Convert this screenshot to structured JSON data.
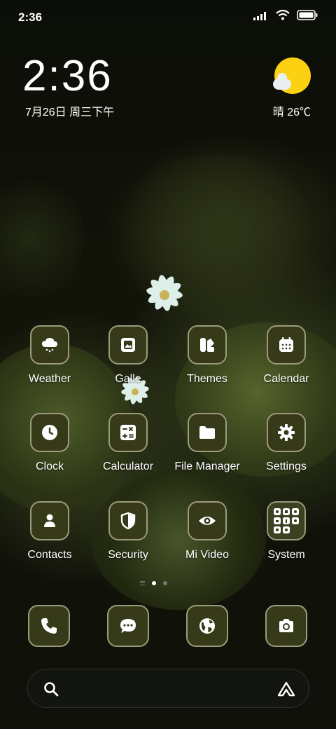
{
  "status_bar": {
    "time": "2:36"
  },
  "lock_clock": {
    "time": "2:36",
    "date": "7月26日 周三下午"
  },
  "weather_widget": {
    "condition_temp": "晴 26℃"
  },
  "apps": [
    {
      "label": "Weather",
      "icon": "weather-icon"
    },
    {
      "label": "Galle",
      "icon": "gallery-icon"
    },
    {
      "label": "Themes",
      "icon": "themes-icon"
    },
    {
      "label": "Calendar",
      "icon": "calendar-icon"
    },
    {
      "label": "Clock",
      "icon": "clock-icon"
    },
    {
      "label": "Calculator",
      "icon": "calculator-icon"
    },
    {
      "label": "File Manager",
      "icon": "folder-icon"
    },
    {
      "label": "Settings",
      "icon": "gear-icon"
    },
    {
      "label": "Contacts",
      "icon": "contacts-icon"
    },
    {
      "label": "Security",
      "icon": "shield-icon"
    },
    {
      "label": "Mi Video",
      "icon": "eye-icon"
    },
    {
      "label": "System",
      "icon": "folder-grid-icon"
    }
  ],
  "dock": [
    {
      "icon": "phone-icon"
    },
    {
      "icon": "messages-icon"
    },
    {
      "icon": "browser-icon"
    },
    {
      "icon": "camera-icon"
    }
  ],
  "page_indicator": {
    "pages": 2,
    "current": 1
  },
  "colors": {
    "icon_bg": "#363a19",
    "icon_border": "#9a9c7c",
    "sun": "#fcd111"
  }
}
